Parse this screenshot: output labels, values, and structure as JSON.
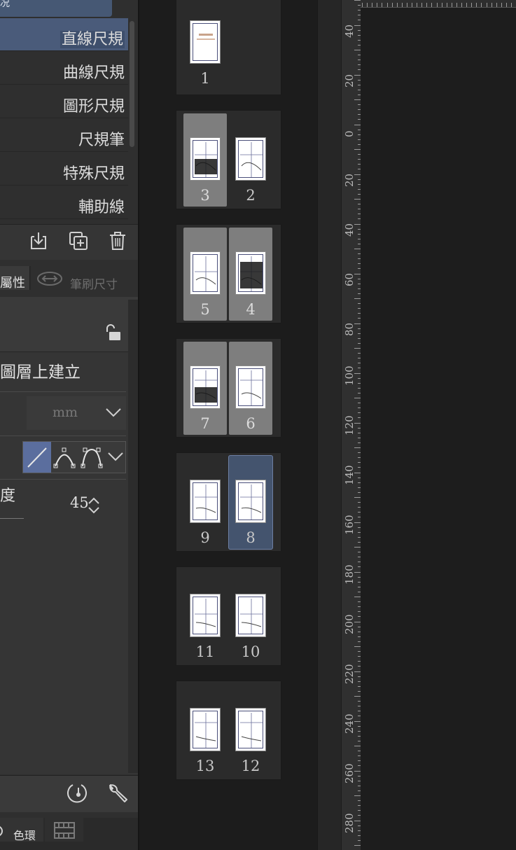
{
  "left_panel": {
    "top_tab_fragment": "况",
    "ruler_items": [
      {
        "label": "直線尺規",
        "selected": true
      },
      {
        "label": "曲線尺規",
        "selected": false
      },
      {
        "label": "圖形尺規",
        "selected": false
      },
      {
        "label": "尺規筆",
        "selected": false
      },
      {
        "label": "特殊尺規",
        "selected": false
      },
      {
        "label": "輔助線",
        "selected": false
      }
    ],
    "tabs": {
      "property": "屬性",
      "brush_size": "筆刷尺寸"
    },
    "properties": {
      "create_on_layer": "圖層上建立",
      "unit": "mm",
      "angle_label": "度",
      "angle_value": "45"
    },
    "bottom_tabs": {
      "color_wheel": "色環"
    }
  },
  "page_manager": {
    "selected_color": "#44546e",
    "spreads": [
      {
        "pages": [
          {
            "num": "1",
            "sel": "none",
            "pos": "left"
          }
        ]
      },
      {
        "pages": [
          {
            "num": "3",
            "sel": "gray",
            "pos": "left"
          },
          {
            "num": "2",
            "sel": "none",
            "pos": "right"
          }
        ]
      },
      {
        "pages": [
          {
            "num": "5",
            "sel": "gray",
            "pos": "left"
          },
          {
            "num": "4",
            "sel": "gray",
            "pos": "right"
          }
        ]
      },
      {
        "pages": [
          {
            "num": "7",
            "sel": "gray",
            "pos": "left"
          },
          {
            "num": "6",
            "sel": "gray",
            "pos": "right"
          }
        ]
      },
      {
        "pages": [
          {
            "num": "9",
            "sel": "none",
            "pos": "left"
          },
          {
            "num": "8",
            "sel": "blue",
            "pos": "right"
          }
        ]
      },
      {
        "pages": [
          {
            "num": "11",
            "sel": "none",
            "pos": "left"
          },
          {
            "num": "10",
            "sel": "none",
            "pos": "right"
          }
        ]
      },
      {
        "pages": [
          {
            "num": "13",
            "sel": "none",
            "pos": "left"
          },
          {
            "num": "12",
            "sel": "none",
            "pos": "right"
          }
        ]
      }
    ]
  },
  "ruler": {
    "labels": [
      "40",
      "20",
      "0",
      "20",
      "40",
      "60",
      "80",
      "100",
      "120",
      "140",
      "160",
      "180",
      "200",
      "220",
      "240",
      "260",
      "280"
    ]
  }
}
